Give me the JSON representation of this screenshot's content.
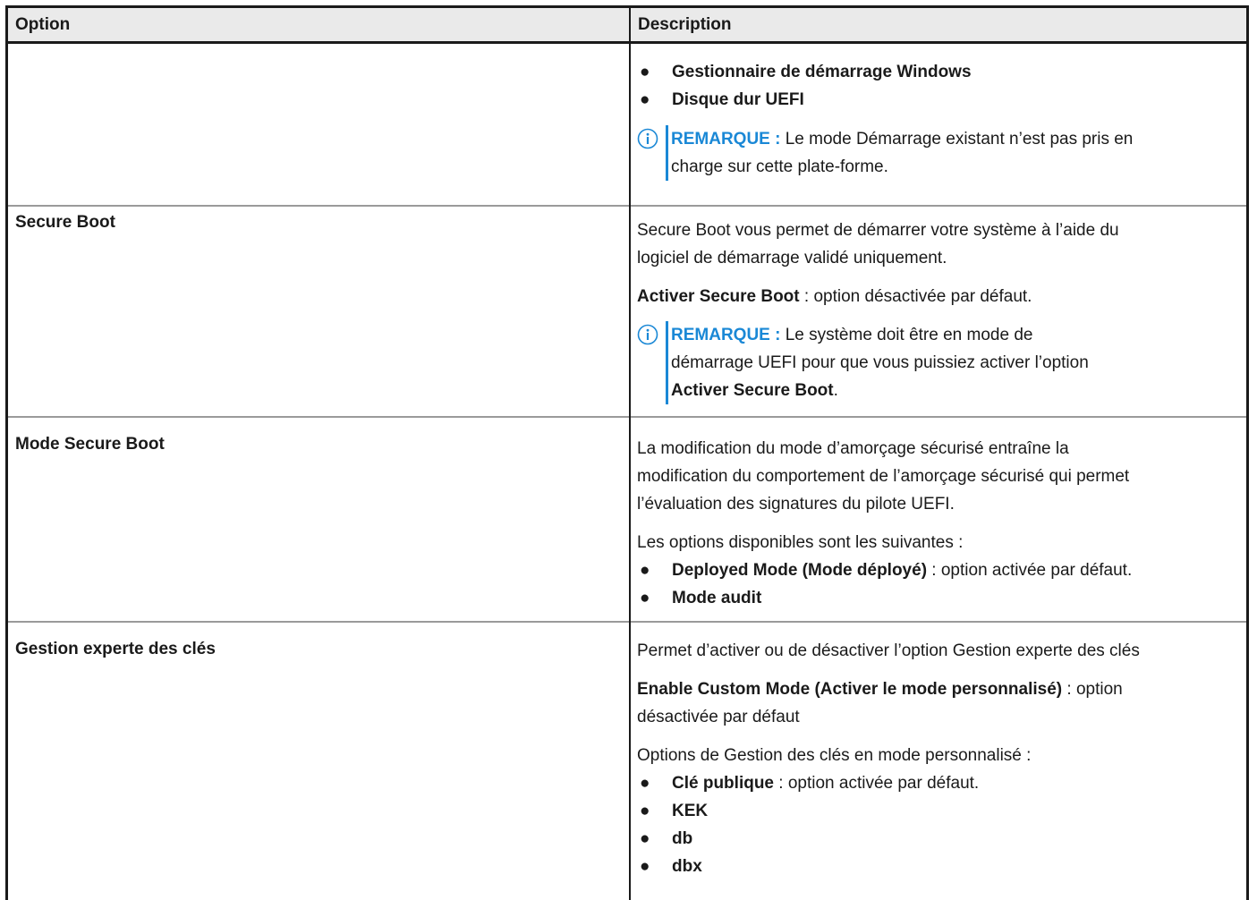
{
  "table": {
    "headers": {
      "option": "Option",
      "description": "Description"
    },
    "row0": {
      "bullets": [
        "Gestionnaire de démarrage Windows",
        "Disque dur UEFI"
      ],
      "note_label": "REMARQUE :",
      "note_line1": " Le mode Démarrage existant n’est pas pris en",
      "note_line2": "charge sur cette plate-forme."
    },
    "row1": {
      "option": "Secure Boot",
      "desc_line1": "Secure Boot vous permet de démarrer votre système à l’aide du",
      "desc_line2": "logiciel de démarrage validé uniquement.",
      "enable_bold": "Activer Secure Boot",
      "enable_rest": " : option désactivée par défaut.",
      "note_label": "REMARQUE :",
      "note_line1": " Le système doit être en mode de",
      "note_line2": "démarrage UEFI pour que vous puissiez activer l’option",
      "note_bold": "Activer Secure Boot",
      "note_end": "."
    },
    "row2": {
      "option": "Mode Secure Boot",
      "desc_line1": "La modification du mode d’amorçage sécurisé entraîne la",
      "desc_line2": "modification du comportement de l’amorçage sécurisé qui permet",
      "desc_line3": "l’évaluation des signatures du pilote UEFI.",
      "options_intro": "Les options disponibles sont les suivantes :",
      "item1_bold": "Deployed Mode (Mode déployé)",
      "item1_rest": " : option activée par défaut.",
      "item2_bold": "Mode audit"
    },
    "row3": {
      "option": "Gestion experte des clés",
      "desc_line1": "Permet d’activer ou de désactiver l’option Gestion experte des clés",
      "custom_bold": "Enable Custom Mode (Activer le mode personnalisé)",
      "custom_rest": " : option",
      "custom_line2": "désactivée par défaut",
      "options_intro": "Options de Gestion des clés en mode personnalisé :",
      "item1_bold": "Clé publique",
      "item1_rest": " : option activée par défaut.",
      "item2": "KEK",
      "item3": "db",
      "item4": "dbx"
    }
  },
  "colors": {
    "note_accent": "#1a88d6",
    "header_bg": "#eaeaea",
    "row_divider": "#9a9a9a"
  },
  "icons": {
    "note": "info-circle-icon",
    "bullet": "bullet-dot"
  }
}
